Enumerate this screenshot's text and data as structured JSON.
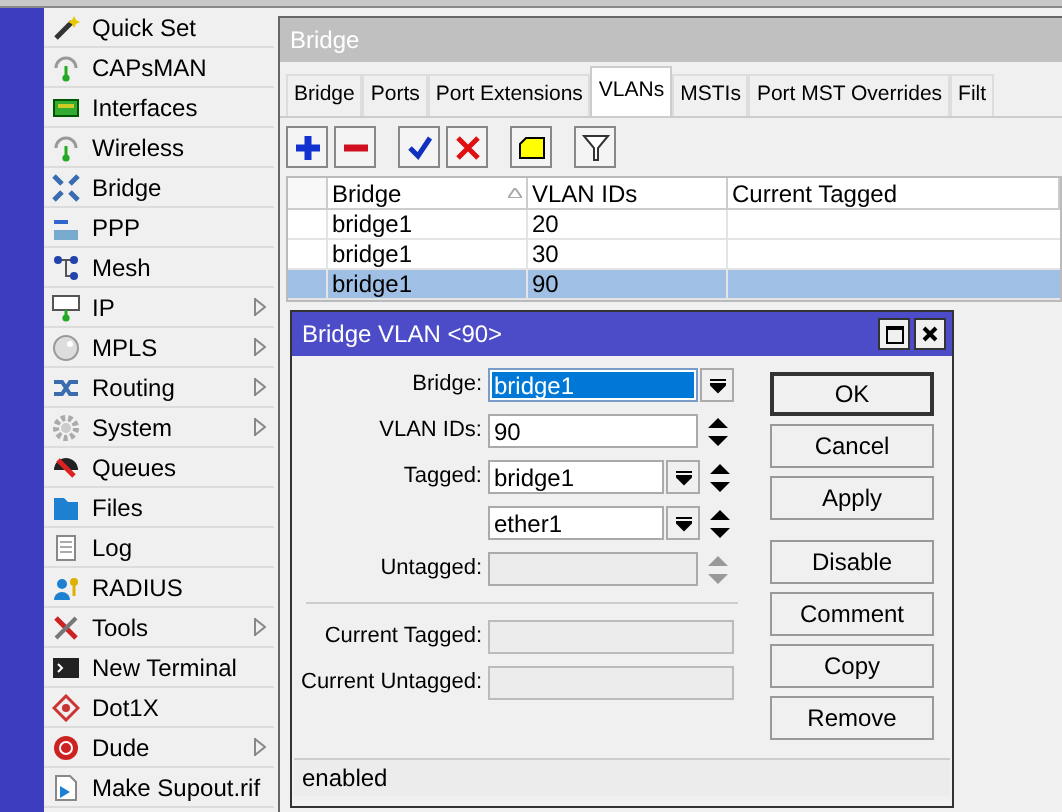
{
  "menu": [
    {
      "label": "Quick Set",
      "submenu": false
    },
    {
      "label": "CAPsMAN",
      "submenu": false
    },
    {
      "label": "Interfaces",
      "submenu": false
    },
    {
      "label": "Wireless",
      "submenu": false
    },
    {
      "label": "Bridge",
      "submenu": false
    },
    {
      "label": "PPP",
      "submenu": false
    },
    {
      "label": "Mesh",
      "submenu": false
    },
    {
      "label": "IP",
      "submenu": true
    },
    {
      "label": "MPLS",
      "submenu": true
    },
    {
      "label": "Routing",
      "submenu": true
    },
    {
      "label": "System",
      "submenu": true
    },
    {
      "label": "Queues",
      "submenu": false
    },
    {
      "label": "Files",
      "submenu": false
    },
    {
      "label": "Log",
      "submenu": false
    },
    {
      "label": "RADIUS",
      "submenu": false
    },
    {
      "label": "Tools",
      "submenu": true
    },
    {
      "label": "New Terminal",
      "submenu": false
    },
    {
      "label": "Dot1X",
      "submenu": false
    },
    {
      "label": "Dude",
      "submenu": true
    },
    {
      "label": "Make Supout.rif",
      "submenu": false
    }
  ],
  "window": {
    "title": "Bridge",
    "tabs": [
      {
        "label": "Bridge",
        "selected": false
      },
      {
        "label": "Ports",
        "selected": false
      },
      {
        "label": "Port Extensions",
        "selected": false
      },
      {
        "label": "VLANs",
        "selected": true
      },
      {
        "label": "MSTIs",
        "selected": false
      },
      {
        "label": "Port MST Overrides",
        "selected": false
      },
      {
        "label": "Filt",
        "selected": false
      }
    ],
    "toolbar": [
      {
        "kind": "add"
      },
      {
        "kind": "remove"
      },
      {
        "kind": "enable"
      },
      {
        "kind": "disable"
      },
      {
        "kind": "comment"
      },
      {
        "kind": "filter"
      }
    ],
    "columns": [
      {
        "label": "Bridge",
        "sorted": true
      },
      {
        "label": "VLAN IDs",
        "sorted": false
      },
      {
        "label": "Current Tagged",
        "sorted": false
      }
    ],
    "rows": [
      {
        "cells": [
          "bridge1",
          "20"
        ],
        "selected": false
      },
      {
        "cells": [
          "bridge1",
          "30"
        ],
        "selected": false
      },
      {
        "cells": [
          "bridge1",
          "90"
        ],
        "selected": true
      }
    ]
  },
  "dialog": {
    "title": "Bridge VLAN <90>",
    "fields": [
      {
        "label": "Bridge:",
        "value": "bridge1",
        "kind": "select",
        "highlighted": true,
        "disabled": false
      },
      {
        "label": "VLAN IDs:",
        "value": "90",
        "kind": "spin",
        "highlighted": false,
        "disabled": false
      },
      {
        "label": "Tagged:",
        "value": "bridge1",
        "kind": "select-spin",
        "highlighted": false,
        "disabled": false
      },
      {
        "value": "ether1",
        "kind": "select-spin",
        "highlighted": false,
        "disabled": false
      },
      {
        "label": "Untagged:",
        "kind": "spin",
        "highlighted": false,
        "disabled": true
      }
    ],
    "readonly": [
      {
        "label": "Current Tagged:"
      },
      {
        "label": "Current Untagged:"
      }
    ],
    "buttons": [
      {
        "label": "OK",
        "default": true
      },
      {
        "label": "Cancel",
        "default": false
      },
      {
        "label": "Apply",
        "default": false
      },
      {
        "label": "Disable",
        "default": false
      },
      {
        "label": "Comment",
        "default": false
      },
      {
        "label": "Copy",
        "default": false
      },
      {
        "label": "Remove",
        "default": false
      }
    ],
    "status": "enabled"
  }
}
